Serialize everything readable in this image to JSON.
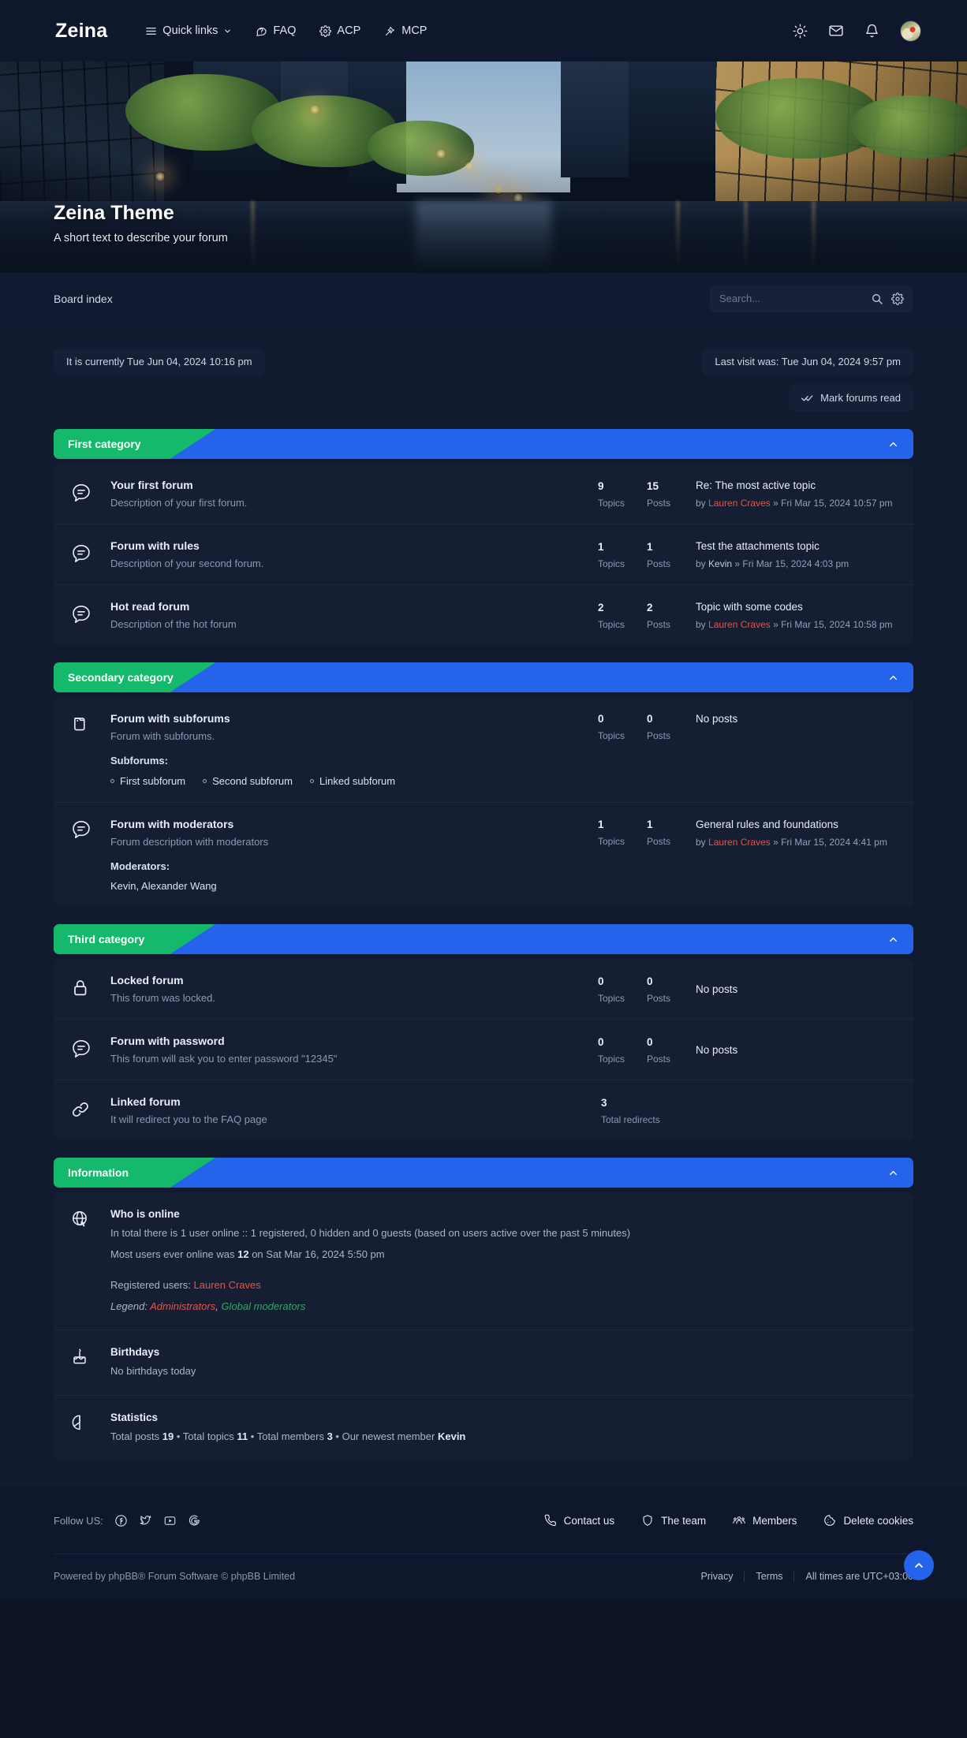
{
  "header": {
    "brand": "Zeina",
    "nav": [
      {
        "label": "Quick links",
        "icon": "menu-icon",
        "caret": true
      },
      {
        "label": "FAQ",
        "icon": "question-icon",
        "caret": false
      },
      {
        "label": "ACP",
        "icon": "gear-icon",
        "caret": false
      },
      {
        "label": "MCP",
        "icon": "wand-icon",
        "caret": false
      }
    ],
    "actions": [
      "sun-icon",
      "envelope-icon",
      "bell-icon",
      "avatar"
    ]
  },
  "hero": {
    "title": "Zeina Theme",
    "subtitle": "A short text to describe your forum"
  },
  "navstrip": {
    "breadcrumb": "Board index",
    "search_placeholder": "Search...",
    "search_value": ""
  },
  "info": {
    "current_time": "It is currently Tue Jun 04, 2024 10:16 pm",
    "last_visit": "Last visit was: Tue Jun 04, 2024 9:57 pm",
    "mark_read": "Mark forums read"
  },
  "labels": {
    "topics": "Topics",
    "posts": "Posts",
    "total_redirects": "Total redirects",
    "no_posts": "No posts",
    "subforums": "Subforums:",
    "moderators": "Moderators:",
    "by": "by"
  },
  "categories": [
    {
      "name": "First category",
      "forums": [
        {
          "icon": "forum-read-icon",
          "title": "Your first forum",
          "desc": "Description of your first forum.",
          "topics": "9",
          "posts": "15",
          "last_title": "Re: The most active topic",
          "last_user": "Lauren Craves",
          "last_user_color": "#e0564a",
          "last_date": "Fri Mar 15, 2024 10:57 pm"
        },
        {
          "icon": "forum-read-icon",
          "title": "Forum with rules",
          "desc": "Description of your second forum.",
          "topics": "1",
          "posts": "1",
          "last_title": "Test the attachments topic",
          "last_user": "Kevin",
          "last_user_color": "#c3ccdb",
          "last_date": "Fri Mar 15, 2024 4:03 pm"
        },
        {
          "icon": "forum-read-icon",
          "title": "Hot read forum",
          "desc": "Description of the hot forum",
          "topics": "2",
          "posts": "2",
          "last_title": "Topic with some codes",
          "last_user": "Lauren Craves",
          "last_user_color": "#e0564a",
          "last_date": "Fri Mar 15, 2024 10:58 pm"
        }
      ]
    },
    {
      "name": "Secondary category",
      "forums": [
        {
          "icon": "folder-icon",
          "title": "Forum with subforums",
          "desc": "Forum with subforums.",
          "subforums": [
            "First subforum",
            "Second subforum",
            "Linked subforum"
          ],
          "topics": "0",
          "posts": "0",
          "no_posts": true
        },
        {
          "icon": "forum-read-icon",
          "title": "Forum with moderators",
          "desc": "Forum description with moderators",
          "moderators": "Kevin,  Alexander Wang",
          "topics": "1",
          "posts": "1",
          "last_title": "General rules and foundations",
          "last_user": "Lauren Craves",
          "last_user_color": "#e0564a",
          "last_date": "Fri Mar 15, 2024 4:41 pm"
        }
      ]
    },
    {
      "name": "Third category",
      "forums": [
        {
          "icon": "lock-icon",
          "title": "Locked forum",
          "desc": "This forum was locked.",
          "topics": "0",
          "posts": "0",
          "no_posts": true
        },
        {
          "icon": "forum-read-icon",
          "title": "Forum with password",
          "desc": "This forum will ask you to enter password \"12345\"",
          "topics": "0",
          "posts": "0",
          "no_posts": true
        },
        {
          "icon": "link-icon",
          "title": "Linked forum",
          "desc": "It will redirect you to the FAQ page",
          "redirects": "3",
          "is_link": true
        }
      ]
    }
  ],
  "information": {
    "name": "Information",
    "blocks": [
      {
        "icon": "globe-icon",
        "head": "Who is online",
        "line1": "In total there is 1 user online :: 1 registered, 0 hidden and 0 guests (based on users active over the past 5 minutes)",
        "line2_pre": "Most users ever online was ",
        "line2_bold": "12",
        "line2_post": " on Sat Mar 16, 2024 5:50 pm",
        "registered_label": "Registered users: ",
        "registered_users": "Lauren Craves",
        "legend_label": "Legend: ",
        "legend_admins": "Administrators",
        "legend_sep": ", ",
        "legend_gmods": "Global moderators"
      },
      {
        "icon": "cake-icon",
        "head": "Birthdays",
        "line1": "No birthdays today"
      },
      {
        "icon": "chart-icon",
        "head": "Statistics",
        "stat_posts_label": "Total posts ",
        "stat_posts": "19",
        "stat_topics_label": " • Total topics ",
        "stat_topics": "11",
        "stat_members_label": " • Total members ",
        "stat_members": "3",
        "stat_newest_label": " • Our newest member ",
        "stat_newest": "Kevin"
      }
    ]
  },
  "footer": {
    "follow_label": "Follow US:",
    "socials": [
      "facebook-icon",
      "twitter-icon",
      "youtube-icon",
      "google-icon"
    ],
    "links": [
      {
        "label": "Contact us",
        "icon": "phone-icon"
      },
      {
        "label": "The team",
        "icon": "shield-icon"
      },
      {
        "label": "Members",
        "icon": "people-icon"
      },
      {
        "label": "Delete cookies",
        "icon": "cookie-icon"
      }
    ],
    "powered": "Powered by phpBB® Forum Software © phpBB Limited",
    "privacy": "Privacy",
    "terms": "Terms",
    "timezone": "All times are UTC+03:00"
  },
  "colors": {
    "accent_blue": "#2563eb",
    "accent_green": "#15b96c",
    "page_bg": "#111a2e",
    "panel_bg": "#151e33",
    "header_bg": "#0f172c",
    "user_red": "#e0564a",
    "mod_green": "#2fa868"
  }
}
